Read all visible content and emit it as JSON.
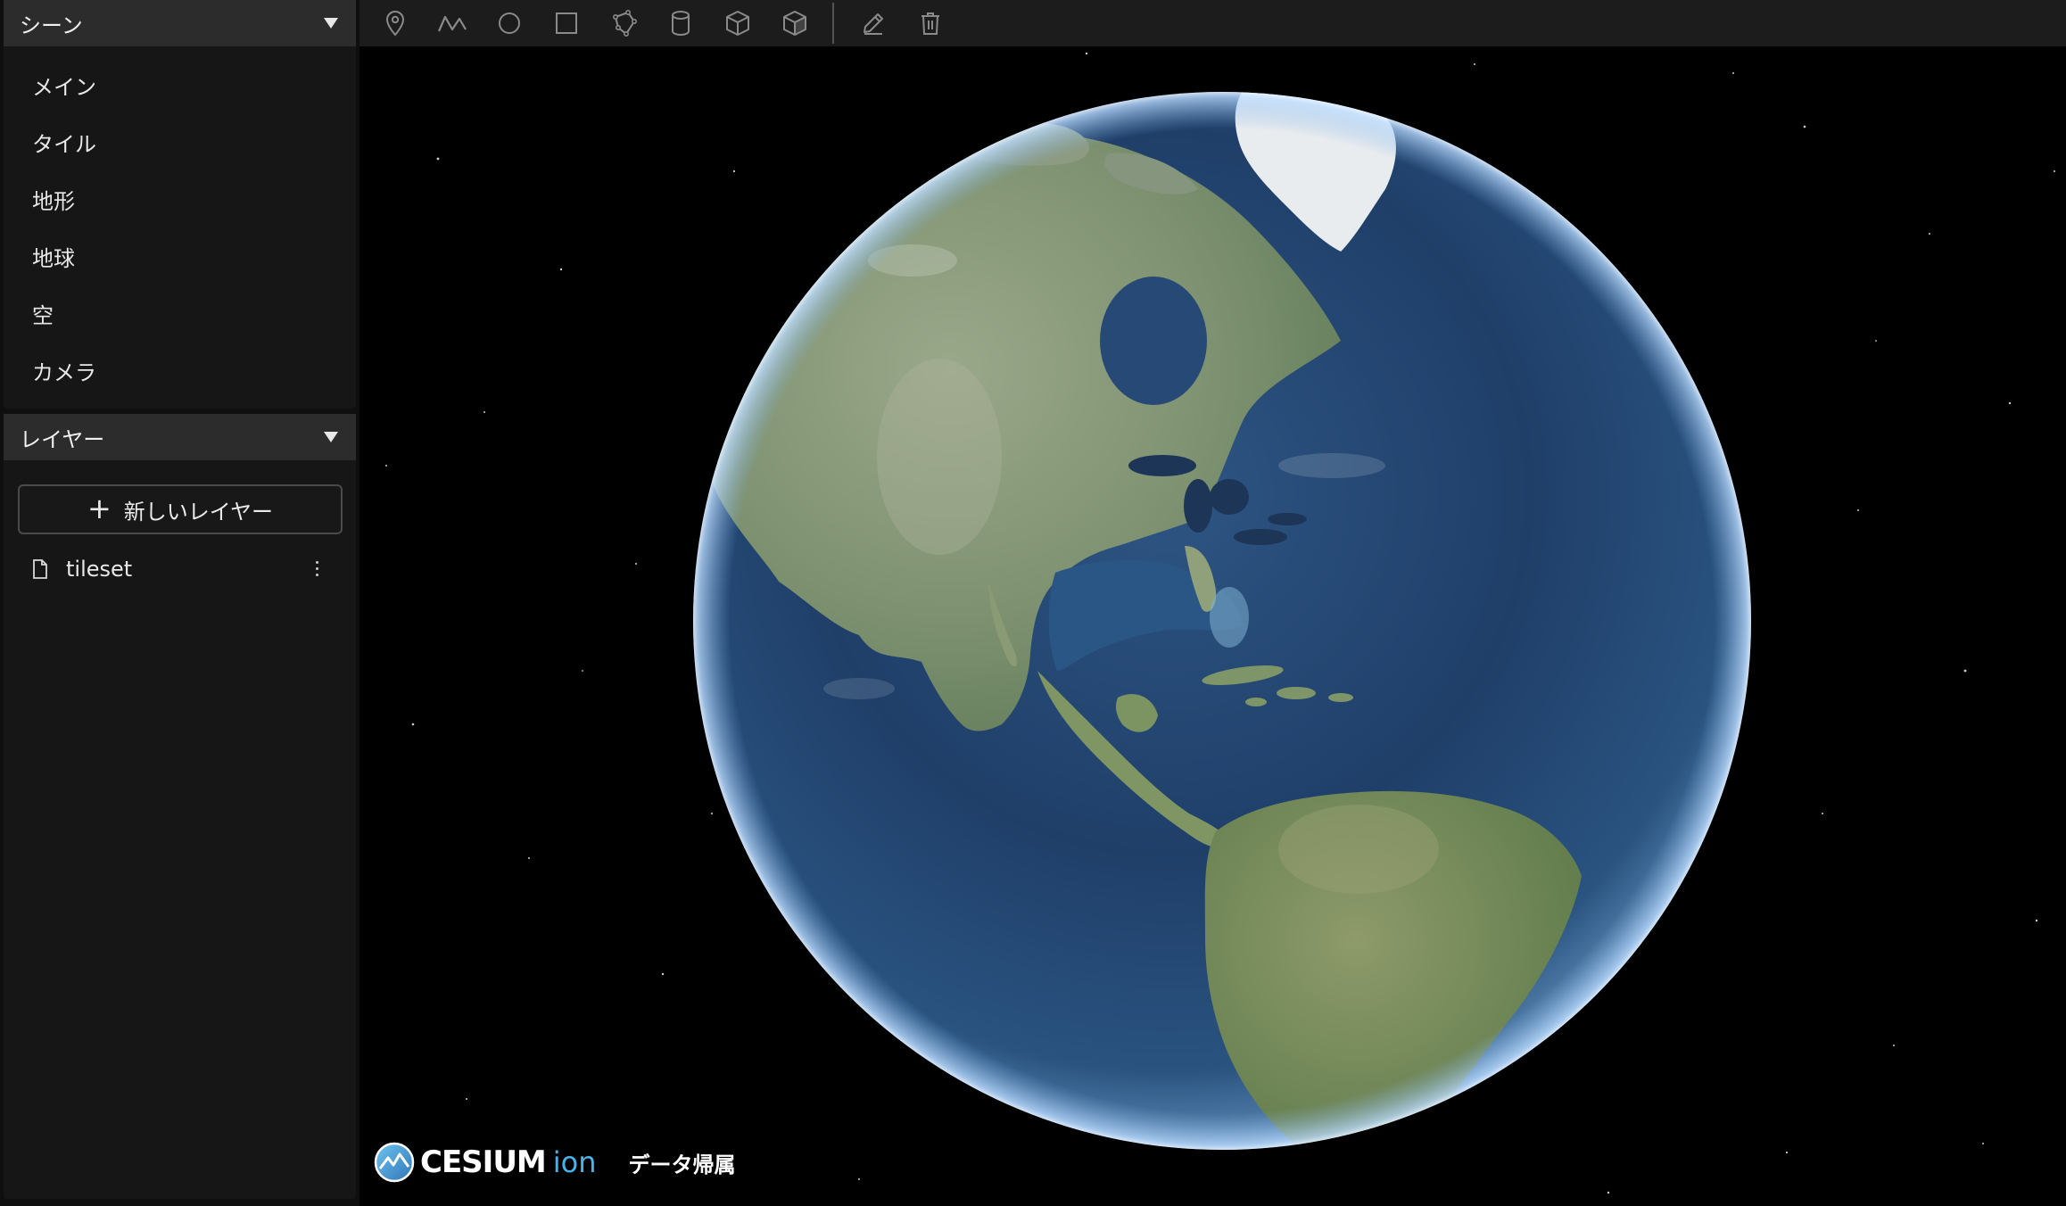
{
  "scene_panel": {
    "title": "シーン",
    "items": [
      {
        "label": "メイン"
      },
      {
        "label": "タイル"
      },
      {
        "label": "地形"
      },
      {
        "label": "地球"
      },
      {
        "label": "空"
      },
      {
        "label": "カメラ"
      }
    ]
  },
  "layer_panel": {
    "title": "レイヤー",
    "new_layer_label": "新しいレイヤー",
    "layers": [
      {
        "name": "tileset"
      }
    ]
  },
  "toolbar": {
    "tools": [
      {
        "icon": "marker-icon"
      },
      {
        "icon": "polyline-icon"
      },
      {
        "icon": "circle-icon"
      },
      {
        "icon": "rectangle-icon"
      },
      {
        "icon": "polygon-icon"
      },
      {
        "icon": "cylinder-icon"
      },
      {
        "icon": "box-icon"
      },
      {
        "icon": "extrude-box-icon"
      },
      {
        "icon": "edit-icon"
      },
      {
        "icon": "trash-icon"
      }
    ]
  },
  "viewer": {
    "logo_text_main": "CESIUM",
    "logo_text_sub": "ion",
    "attribution_label": "データ帰属"
  },
  "colors": {
    "sidebar_bg": "#161616",
    "header_bg": "#2c2c2c",
    "toolbar_bg": "#1c1c1c",
    "icon": "#8a8a8a",
    "ion_accent": "#48b3e6",
    "space": "#000000"
  }
}
